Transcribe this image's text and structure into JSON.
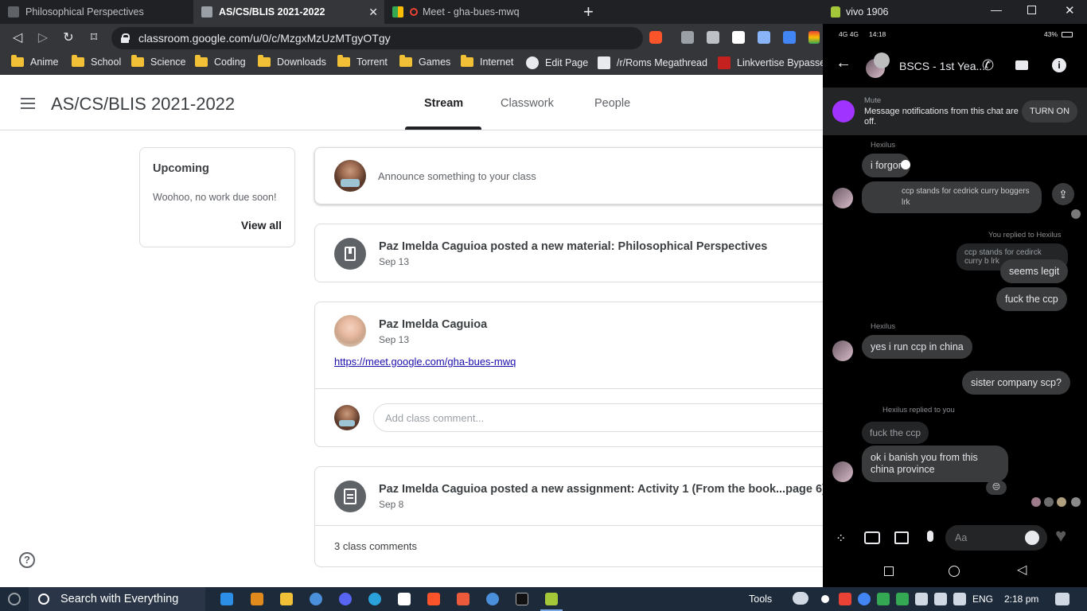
{
  "browser": {
    "tabs": [
      {
        "title": "Philosophical Perspectives"
      },
      {
        "title": "AS/CS/BLIS 2021-2022"
      },
      {
        "title": "Meet - gha-bues-mwq"
      }
    ],
    "url": "classroom.google.com/u/0/c/MzgxMzUzMTgyOTgy",
    "bookmarks": [
      "Anime",
      "School",
      "Science",
      "Coding",
      "Downloads",
      "Torrent",
      "Games",
      "Internet",
      "Edit Page",
      "/r/Roms Megathread",
      "Linkvertise Bypasser"
    ]
  },
  "classroom": {
    "class_title": "AS/CS/BLIS 2021-2022",
    "tabs": [
      "Stream",
      "Classwork",
      "People"
    ],
    "upcoming": {
      "title": "Upcoming",
      "status": "Woohoo, no work due soon!",
      "view_all": "View all"
    },
    "announce_placeholder": "Announce something to your class",
    "posts": [
      {
        "title": "Paz Imelda Caguioa posted a new material: Philosophical Perspectives",
        "date": "Sep 13"
      },
      {
        "author": "Paz Imelda Caguioa",
        "date": "Sep 13",
        "link": "https://meet.google.com/gha-bues-mwq",
        "comment_placeholder": "Add class comment..."
      },
      {
        "title": "Paz Imelda Caguioa posted a new assignment: Activity 1 (From the book...page 6)",
        "date": "Sep 8",
        "comments": "3 class comments"
      }
    ]
  },
  "phone": {
    "window_title": "vivo 1906",
    "status": {
      "time": "14:18",
      "battery": "43%",
      "network": "4G 4G"
    },
    "chat_title": "BSCS - 1st Yea...",
    "mute": {
      "label": "Mute",
      "text": "Message notifications from this chat are off.",
      "button": "TURN ON"
    },
    "messages": {
      "sender1": "Hexilus",
      "m1": "i forgor",
      "m2": "ccp stands for cedrick curry boggers lrk",
      "reply_label": "You replied to Hexilus",
      "quote1": "ccp stands for cedirck curry b lrk",
      "m3": "seems legit",
      "m4": "fuck the ccp",
      "sender2": "Hexilus",
      "m5": "yes i run ccp in china",
      "m6": "sister company scp?",
      "reply_label2": "Hexilus replied to you",
      "quote2": "fuck the ccp",
      "m7": "ok i banish you from this china province",
      "reaction": "😔"
    },
    "input_placeholder": "Aa"
  },
  "taskbar": {
    "search": "Search with Everything",
    "tools": "Tools",
    "lang": "ENG",
    "time": "2:18 pm"
  }
}
